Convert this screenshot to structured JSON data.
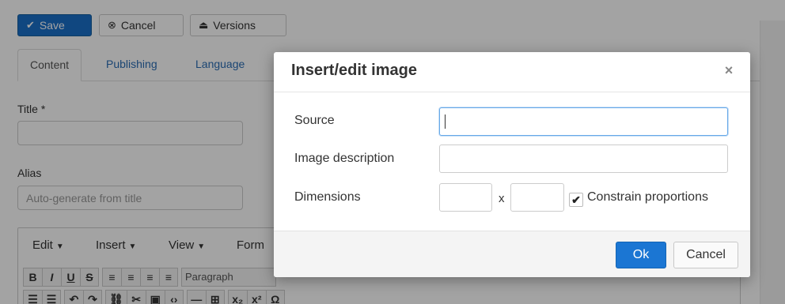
{
  "toolbar": {
    "save_label": "Save",
    "cancel_label": "Cancel",
    "versions_label": "Versions"
  },
  "tabs": [
    {
      "label": "Content",
      "active": true
    },
    {
      "label": "Publishing",
      "active": false
    },
    {
      "label": "Language",
      "active": false
    }
  ],
  "form": {
    "title_label": "Title *",
    "title_value": "",
    "alias_label": "Alias",
    "alias_placeholder": "Auto-generate from title"
  },
  "editor": {
    "menu": [
      "Edit",
      "Insert",
      "View",
      "Form"
    ],
    "format_select": "Paragraph",
    "row1": [
      "B",
      "I",
      "U",
      "S"
    ],
    "row2_symbols": [
      "x₂",
      "x²",
      "Ω"
    ]
  },
  "dialog": {
    "title": "Insert/edit image",
    "close_glyph": "×",
    "source_label": "Source",
    "source_value": "",
    "description_label": "Image description",
    "description_value": "",
    "dimensions_label": "Dimensions",
    "width_value": "",
    "height_value": "",
    "times_glyph": "x",
    "constrain_label": "Constrain proportions",
    "constrain_checked": true,
    "ok_label": "Ok",
    "cancel_label": "Cancel"
  },
  "colors": {
    "primary": "#1b76d3",
    "link": "#2a6db5",
    "overlay": "rgba(0,0,0,0.36)"
  }
}
